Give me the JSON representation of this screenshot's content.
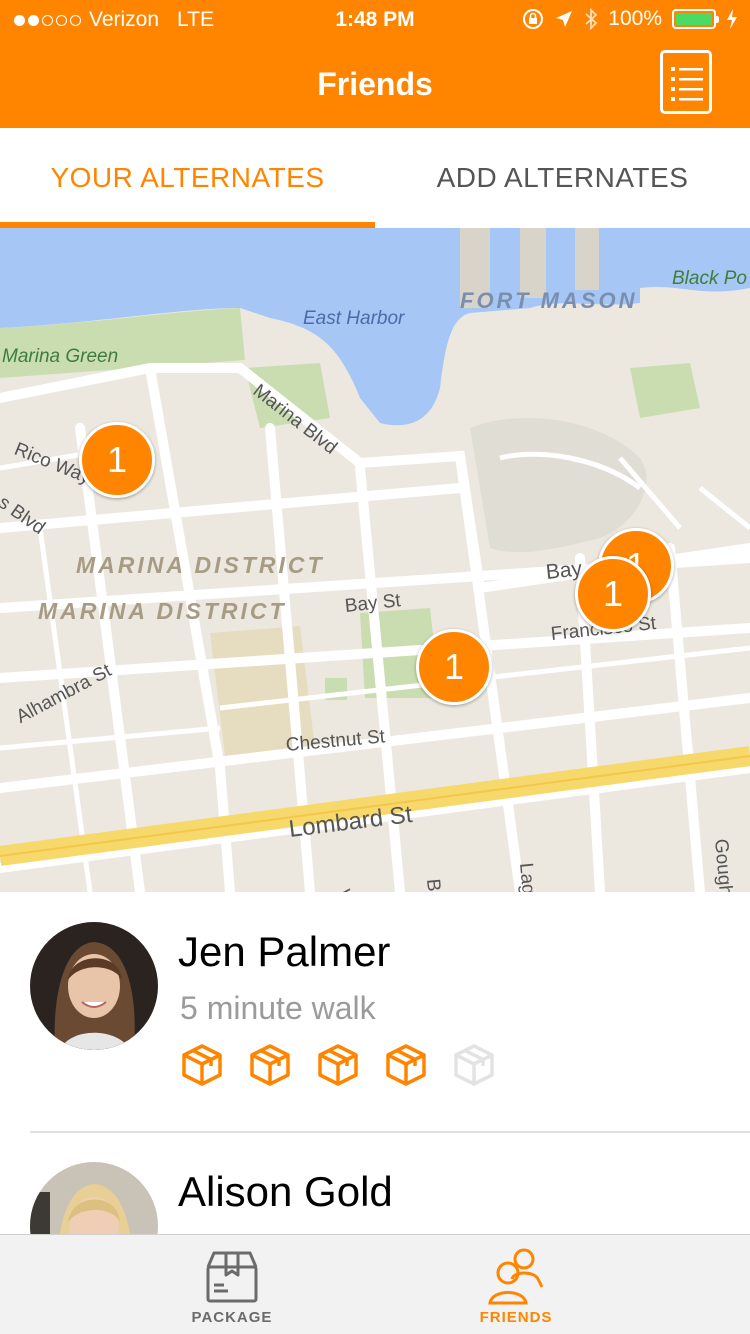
{
  "status_bar": {
    "carrier": "Verizon",
    "network": "LTE",
    "time": "1:48 PM",
    "battery": "100%",
    "battery_level": 1.0
  },
  "nav": {
    "title": "Friends",
    "list_icon": "list-icon"
  },
  "tabs": {
    "active_label": "YOUR ALTERNATES",
    "inactive_label": "ADD ALTERNATES"
  },
  "map": {
    "labels": {
      "east_harbor": "East Harbor",
      "fort_mason": "FORT MASON",
      "black_point": "Black Po",
      "marina_green": "Marina Green",
      "marina_blvd": "Marina Blvd",
      "rico_way": "Rico Way",
      "blvd_fragment": "s Blvd",
      "marina_district_1": "MARINA DISTRICT",
      "marina_district_2": "MARINA DISTRICT",
      "bay_st": "Bay St",
      "bay_fragment": "Bay",
      "francisco_st": "Francisco St",
      "alhambra_st": "Alhambra St",
      "chestnut_st": "Chestnut St",
      "lombard_st": "Lombard St",
      "gough_st": "Gough S",
      "lagu_fragment": "Lagu",
      "bu_fragment": "Bu",
      "v_fragment": "V"
    },
    "pins": [
      {
        "count": "1"
      },
      {
        "count": "1"
      },
      {
        "count": "1"
      },
      {
        "count": "1"
      }
    ]
  },
  "friends": [
    {
      "name": "Jen Palmer",
      "distance": "5 minute walk",
      "packages_filled": 4,
      "packages_total": 5
    },
    {
      "name": "Alison Gold"
    }
  ],
  "tabbar": {
    "package_label": "PACKAGE",
    "friends_label": "FRIENDS"
  },
  "colors": {
    "accent": "#FF8500",
    "inactive_gray": "#6b6b6b"
  }
}
